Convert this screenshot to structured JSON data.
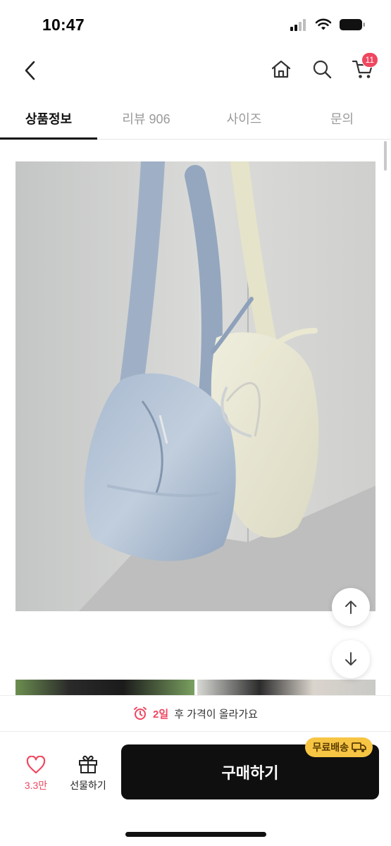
{
  "status_bar": {
    "time": "10:47"
  },
  "nav": {
    "cart_count": "11"
  },
  "tabs": [
    {
      "label": "상품정보",
      "active": true
    },
    {
      "label": "리뷰 906",
      "active": false
    },
    {
      "label": "사이즈",
      "active": false
    },
    {
      "label": "문의",
      "active": false
    }
  ],
  "price_notice": {
    "days": "2일",
    "text": "후 가격이 올라가요"
  },
  "bottom_bar": {
    "like_count": "3.3만",
    "gift_label": "선물하기",
    "buy_label": "구매하기",
    "free_shipping_label": "무료배송"
  },
  "colors": {
    "accent": "#ef4760",
    "buy_button": "#0f0f0f",
    "free_shipping_badge": "#f7c544"
  }
}
